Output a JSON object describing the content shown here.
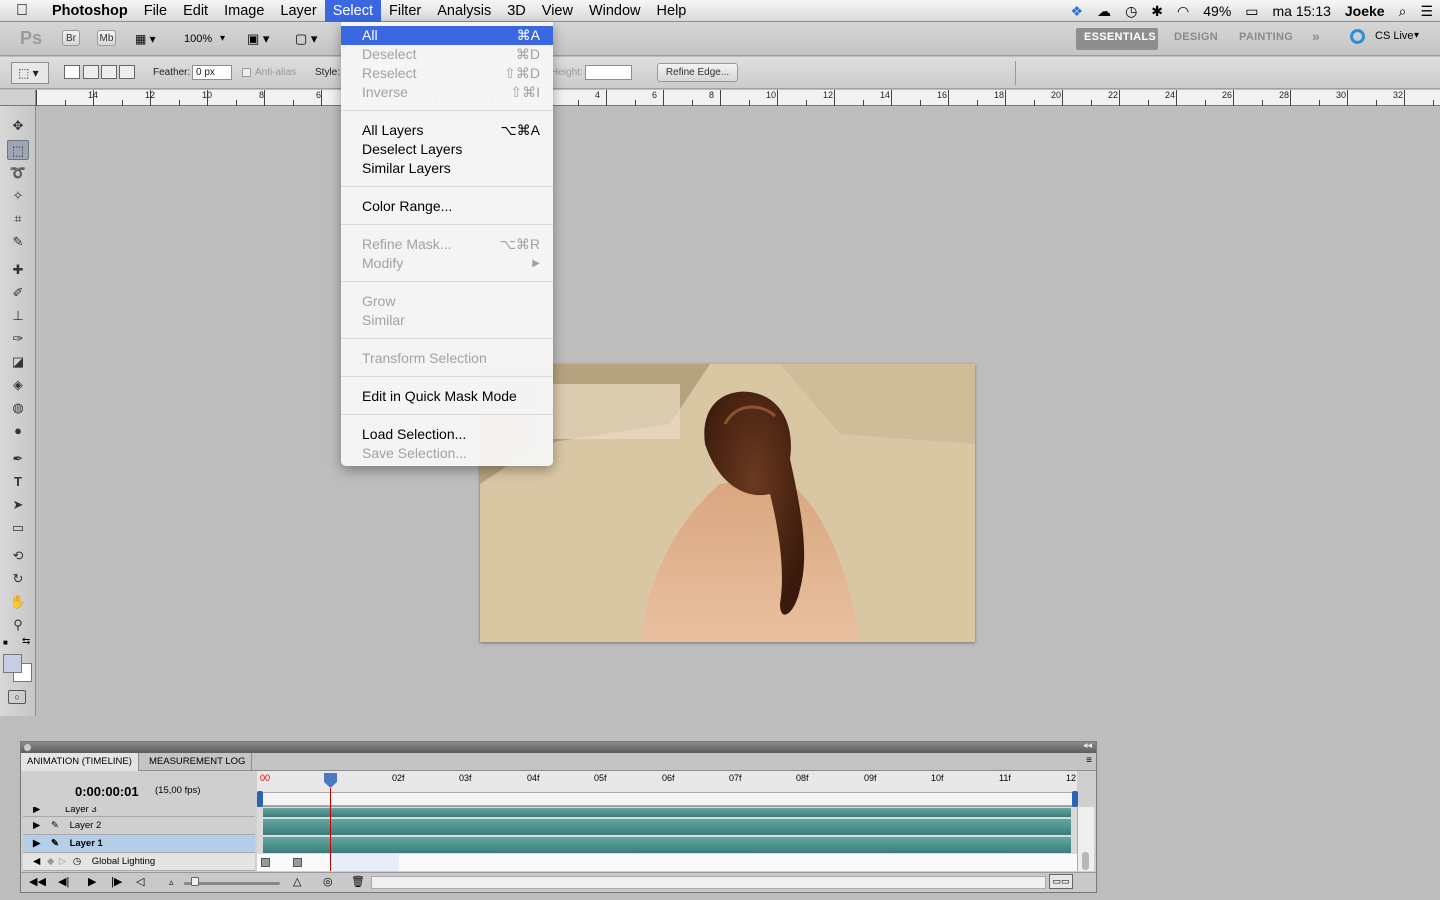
{
  "menubar": {
    "app": "Photoshop",
    "items": [
      "File",
      "Edit",
      "Image",
      "Layer",
      "Select",
      "Filter",
      "Analysis",
      "3D",
      "View",
      "Window",
      "Help"
    ],
    "active": "Select",
    "battery": "49%",
    "clock": "ma 15:13",
    "user": "Joeke"
  },
  "appbar": {
    "ps_logo": "Ps",
    "br": "Br",
    "mb": "Mb",
    "zoom": "100%",
    "workspaces": [
      "ESSENTIALS",
      "DESIGN",
      "PAINTING"
    ],
    "more": "»",
    "cslive": "CS Live"
  },
  "options": {
    "feather_label": "Feather:",
    "feather_value": "0 px",
    "antialias": "Anti-alias",
    "style_label": "Style:",
    "height_label": "Height:",
    "refine_edge": "Refine Edge..."
  },
  "ruler": {
    "labels_left": [
      "14",
      "12",
      "10",
      "8",
      "6"
    ],
    "labels_right": [
      "4",
      "6",
      "8",
      "10",
      "12",
      "14",
      "16",
      "18",
      "20",
      "22",
      "24",
      "26",
      "28",
      "30",
      "32"
    ]
  },
  "select_menu": {
    "items": [
      {
        "label": "All",
        "shortcut": "⌘A",
        "state": "highlighted"
      },
      {
        "label": "Deselect",
        "shortcut": "⌘D",
        "state": "disabled"
      },
      {
        "label": "Reselect",
        "shortcut": "⇧⌘D",
        "state": "disabled"
      },
      {
        "label": "Inverse",
        "shortcut": "⇧⌘I",
        "state": "disabled"
      },
      {
        "label": "All Layers",
        "shortcut": "⌥⌘A",
        "state": "enabled"
      },
      {
        "label": "Deselect Layers",
        "shortcut": "",
        "state": "enabled"
      },
      {
        "label": "Similar Layers",
        "shortcut": "",
        "state": "enabled"
      },
      {
        "label": "Color Range...",
        "shortcut": "",
        "state": "enabled"
      },
      {
        "label": "Refine Mask...",
        "shortcut": "⌥⌘R",
        "state": "disabled"
      },
      {
        "label": "Modify",
        "shortcut": "▶",
        "state": "disabled"
      },
      {
        "label": "Grow",
        "shortcut": "",
        "state": "disabled"
      },
      {
        "label": "Similar",
        "shortcut": "",
        "state": "disabled"
      },
      {
        "label": "Transform Selection",
        "shortcut": "",
        "state": "disabled"
      },
      {
        "label": "Edit in Quick Mask Mode",
        "shortcut": "",
        "state": "enabled"
      },
      {
        "label": "Load Selection...",
        "shortcut": "",
        "state": "enabled"
      },
      {
        "label": "Save Selection...",
        "shortcut": "",
        "state": "disabled"
      }
    ]
  },
  "animation": {
    "tabs": [
      "ANIMATION (TIMELINE)",
      "MEASUREMENT LOG"
    ],
    "timecode": "0:00:00:01",
    "fps": "(15,00 fps)",
    "frames": [
      "00",
      "02f",
      "03f",
      "04f",
      "05f",
      "06f",
      "07f",
      "08f",
      "09f",
      "10f",
      "11f",
      "12"
    ],
    "layers": [
      "Layer 3",
      "Layer 2",
      "Layer 1"
    ],
    "global_lighting": "Global Lighting"
  },
  "colors": {
    "highlight": "#3b68e0",
    "track": "#4f918d"
  }
}
